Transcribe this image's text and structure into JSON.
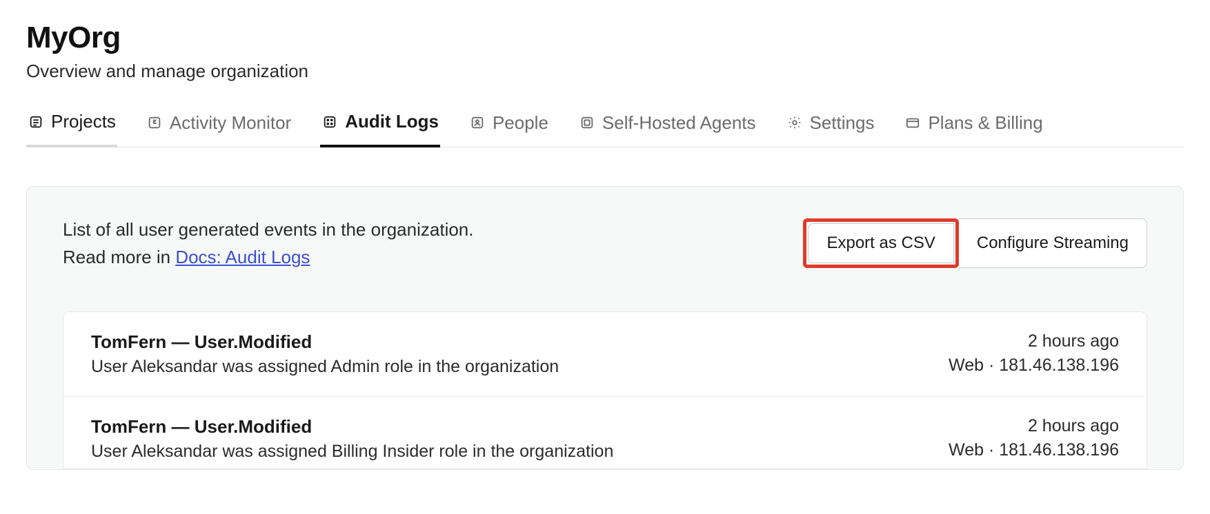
{
  "header": {
    "title": "MyOrg",
    "subtitle": "Overview and manage organization"
  },
  "tabs": [
    {
      "label": "Projects"
    },
    {
      "label": "Activity Monitor"
    },
    {
      "label": "Audit Logs"
    },
    {
      "label": "People"
    },
    {
      "label": "Self-Hosted Agents"
    },
    {
      "label": "Settings"
    },
    {
      "label": "Plans & Billing"
    }
  ],
  "panel": {
    "description": "List of all user generated events in the organization.",
    "read_more_prefix": "Read more in ",
    "docs_link_text": "Docs: Audit Logs",
    "export_button": "Export as CSV",
    "configure_button": "Configure Streaming"
  },
  "logs": [
    {
      "title": "TomFern — User.Modified",
      "description": "User Aleksandar was assigned Admin role in the organization",
      "time": "2 hours ago",
      "meta": "Web · 181.46.138.196"
    },
    {
      "title": "TomFern — User.Modified",
      "description": "User Aleksandar was assigned Billing Insider role in the organization",
      "time": "2 hours ago",
      "meta": "Web · 181.46.138.196"
    }
  ]
}
